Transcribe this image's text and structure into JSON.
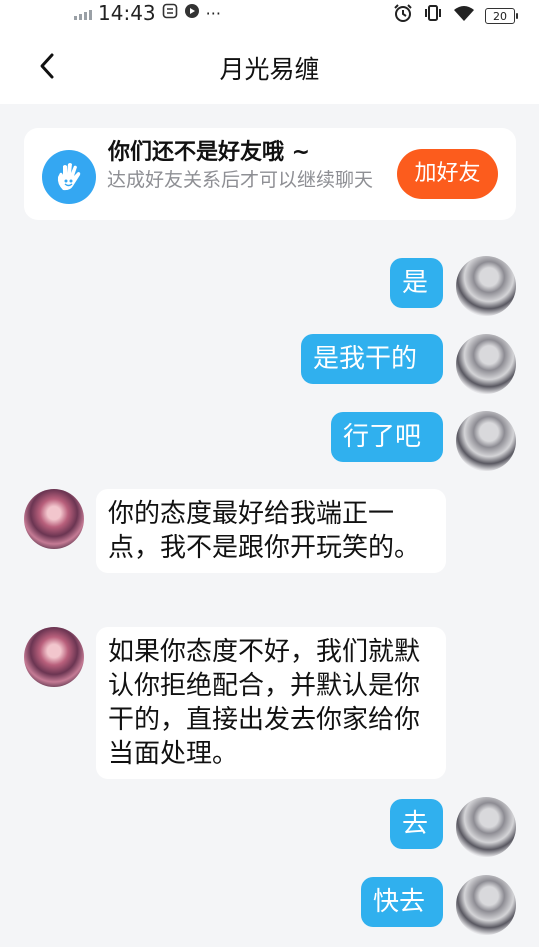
{
  "status_bar": {
    "time": "14:43",
    "icons": [
      "signal-icon",
      "screen-record-icon",
      "record-icon",
      "more-icon",
      "alarm-icon",
      "vibrate-icon",
      "wifi-icon",
      "battery-icon"
    ],
    "more": "···",
    "battery_level": "20"
  },
  "header": {
    "title": "月光易缠",
    "back_icon": "chevron-left-icon"
  },
  "friend_card": {
    "icon": "hand-icon",
    "title": "你们还不是好友哦 ~",
    "subtitle": "达成好友关系后才可以继续聊天",
    "add_button": "加好友",
    "colors": {
      "accent": "#fc5c1d",
      "icon_bg": "#34a7f2"
    }
  },
  "messages": [
    {
      "sender": "me",
      "text": "是"
    },
    {
      "sender": "me",
      "text": "是我干的"
    },
    {
      "sender": "me",
      "text": "行了吧"
    },
    {
      "sender": "other",
      "text": "你的态度最好给我端正一点，我不是跟你开玩笑的。"
    },
    {
      "sender": "other",
      "text": "如果你态度不好，我们就默认你拒绝配合，并默认是你干的，直接出发去你家给你当面处理。"
    },
    {
      "sender": "me",
      "text": "去"
    },
    {
      "sender": "me",
      "text": "快去"
    }
  ],
  "colors": {
    "my_bubble": "#30b0ee",
    "background": "#f4f5f7"
  }
}
